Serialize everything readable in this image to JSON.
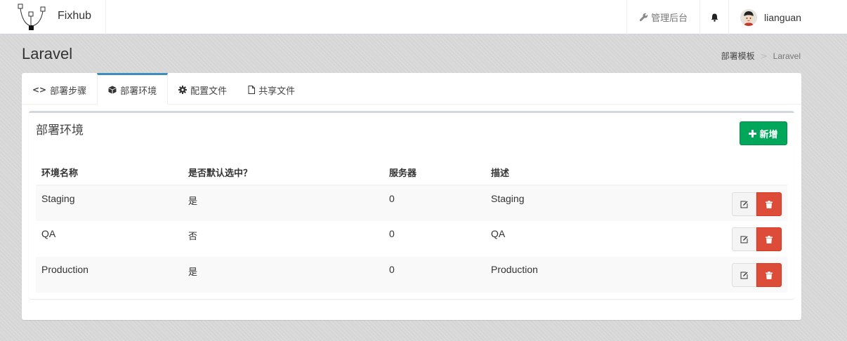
{
  "app": {
    "brand": "Fixhub"
  },
  "topnav": {
    "admin_label": "管理后台",
    "username": "lianguan"
  },
  "page": {
    "title": "Laravel"
  },
  "breadcrumb": {
    "parent": "部署模板",
    "sep": ">",
    "current": "Laravel"
  },
  "tabs": [
    {
      "label": "部署步骤",
      "icon": "code-icon"
    },
    {
      "label": "部署环境",
      "icon": "cube-icon",
      "active": true
    },
    {
      "label": "配置文件",
      "icon": "gear-icon"
    },
    {
      "label": "共享文件",
      "icon": "file-icon"
    }
  ],
  "section": {
    "title": "部署环境",
    "add_label": "新增"
  },
  "table": {
    "headers": [
      "环境名称",
      "是否默认选中？",
      "服务器",
      "描述"
    ],
    "rows": [
      {
        "name": "Staging",
        "default": "是",
        "servers": "0",
        "description": "Staging"
      },
      {
        "name": "QA",
        "default": "否",
        "servers": "0",
        "description": "QA"
      },
      {
        "name": "Production",
        "default": "是",
        "servers": "0",
        "description": "Production"
      }
    ]
  },
  "colors": {
    "accent": "#3c8dbc",
    "success": "#00a65a",
    "danger": "#dd4b39"
  }
}
